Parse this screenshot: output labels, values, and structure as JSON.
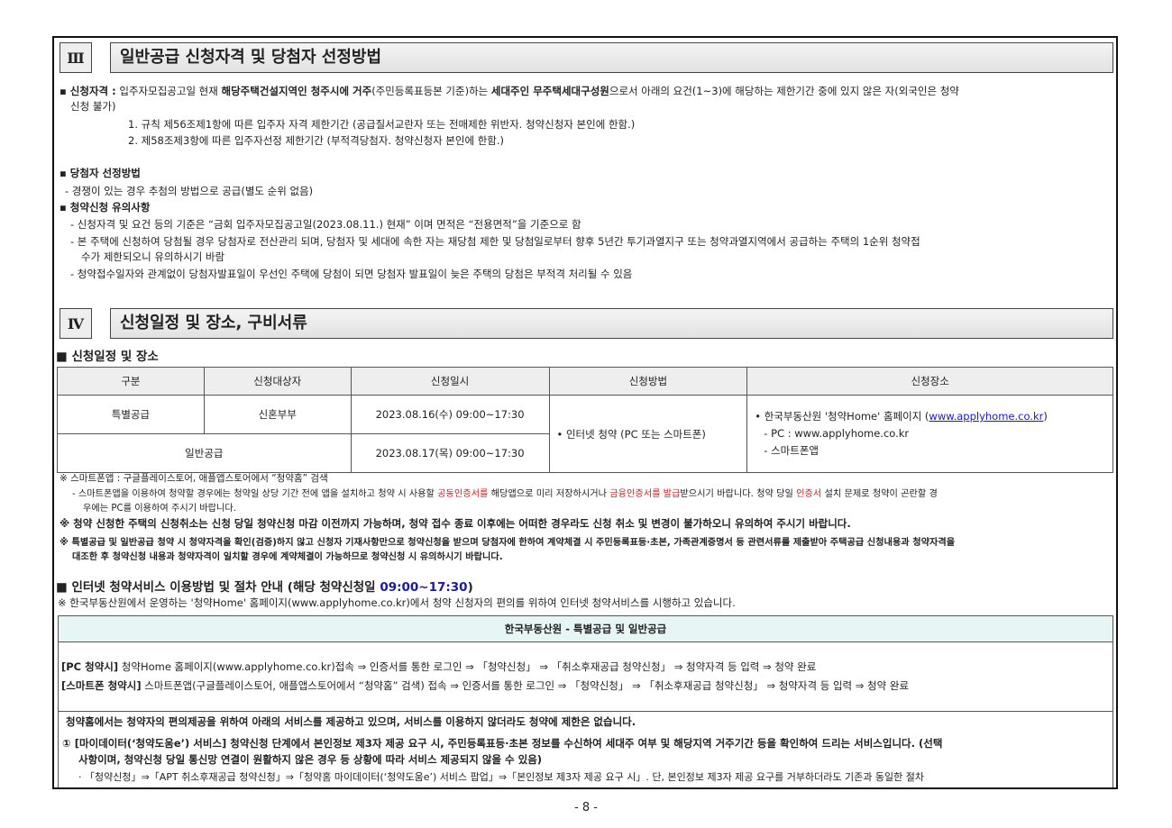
{
  "sec3": {
    "num": "Ⅲ",
    "title": "일반공급 신청자격 및 당첨자 선정방법",
    "qual_label": "▪ 신청자격 :",
    "qual_a": " 입주자모집공고일 현재 ",
    "qual_b": "해당주택건설지역인 청주시에 거주",
    "qual_c": "(주민등록표등본 기준)하는 ",
    "qual_d": "세대주인 무주택세대구성원",
    "qual_e": "으로서 아래의 요건(1~3)에 해당하는 제한기간 중에 있지 않은 자(외국인은 청약",
    "qual_cont": "신청 불가)",
    "rule1": "1. 규칙 제56조제1항에 따른 입주자 자격 제한기간 (공급질서교란자 또는 전매제한 위반자. 청약신청자 본인에 한함.)",
    "rule2": "2. 제58조제3항에 따른 입주자선정 제한기간 (부적격당첨자. 청약신청자 본인에 한함.)",
    "winner_head": "▪ 당첨자 선정방법",
    "winner_line": "- 경쟁이 있는 경우 추첨의 방법으로 공급(별도 순위 없음)",
    "caution_head": "▪ 청약신청 유의사항",
    "caution1": "- 신청자격 및 요건 등의 기준은 “금회 입주자모집공고일(2023.08.11.) 현재” 이며 면적은 “전용면적”을 기준으로 함",
    "caution2": "- 본 주택에 신청하여 당첨될 경우 당첨자로 전산관리 되며, 당첨자 및 세대에 속한 자는 재당첨 제한 및 당첨일로부터 향후 5년간 투기과열지구 또는 청약과열지역에서 공급하는 주택의 1순위 청약접",
    "caution2_cont": "수가 제한되오니 유의하시기 바람",
    "caution3": "- 청약접수일자와 관계없이 당첨자발표일이 우선인 주택에 당첨이 되면 당첨자 발표일이 늦은 주택의 당첨은 부적격 처리될 수 있음"
  },
  "sec4": {
    "num": "Ⅳ",
    "title": "신청일정 및 장소, 구비서류",
    "sched_head": "■ 신청일정 및 장소",
    "table": {
      "headers": [
        "구분",
        "신청대상자",
        "신청일시",
        "신청방법",
        "신청장소"
      ],
      "row1": [
        "특별공급",
        "신혼부부",
        "2023.08.16(수) 09:00~17:30"
      ],
      "row2": [
        "일반공급",
        "2023.08.17(목) 09:00~17:30"
      ],
      "method": "• 인터넷 청약 (PC 또는 스마트폰)",
      "place_a": "• 한국부동산원 '청약Home' 홈페이지 (",
      "place_link": "www.applyhome.co.kr",
      "place_b": ")",
      "place_pc": "- PC : www.applyhome.co.kr",
      "place_app": "- 스마트폰앱"
    },
    "note1": "※ 스마트폰앱 : 구글플레이스토어, 애플앱스토어에서 “청약홈” 검색",
    "note1_sub_a": "- 스마트폰앱을 이용하여 청약할 경우에는 청약일 상당 기간 전에 앱을 설치하고 청약 시 사용할 ",
    "note1_sub_r1": "공동인증서를",
    "note1_sub_b": " 해당앱으로 미리 저장하시거나 ",
    "note1_sub_r2": "금융인증서를 발급",
    "note1_sub_c": "받으시기 바랍니다. 청약 당일 ",
    "note1_sub_r3": "인증서",
    "note1_sub_d": " 설치 문제로 청약이 곤란할 경",
    "note1_sub_cont": "우에는 PC를 이용하여 주시기 바랍니다.",
    "note2": "※ 청약 신청한 주택의 신청취소는 신청 당일 청약신청 마감 이전까지 가능하며, 청약 접수 종료 이후에는 어떠한 경우라도 신청 취소 및 변경이 불가하오니 유의하여 주시기 바랍니다.",
    "note3": "※ 특별공급 및 일반공급 청약 시 청약자격을 확인(검증)하지 않고 신청자 기재사항만으로 청약신청을 받으며 당첨자에 한하여 계약체결 시 주민등록표등·초본, 가족관계증명서 등 관련서류를 제출받아 주택공급 신청내용과 청약자격을",
    "note3_cont": "대조한 후 청약신청 내용과 청약자격이 일치할 경우에 계약체결이 가능하므로 청약신청 시 유의하시기 바랍니다.",
    "net_head": "■ 인터넷 청약서비스 이용방법 및 절차 안내 (해당 청약신청일 ",
    "net_time": "09:00~17:30",
    "net_close": ")",
    "net_sub": "※ 한국부동산원에서 운영하는 '청약Home' 홈페이지(www.applyhome.co.kr)에서 청약 신청자의 편의를 위하여 인터넷 청약서비스를 시행하고 있습니다.",
    "box_title": "한국부동산원 - 특별공급 및 일반공급",
    "pc_label": "[PC 청약시]",
    "pc_text": " 청약Home 홈페이지(www.applyhome.co.kr)접속 ⇒ 인증서를 통한 로그인 ⇒ 「청약신청」 ⇒ 「취소후재공급 청약신청」 ⇒ 청약자격 등 입력 ⇒ 청약 완료",
    "sp_label": "[스마트폰 청약시]",
    "sp_text": " 스마트폰앱(구글플레이스토어, 애플앱스토어에서 “청약홈” 검색) 접속 ⇒ 인증서를 통한 로그인 ⇒ 「청약신청」 ⇒ 「취소후재공급 청약신청」 ⇒ 청약자격 등 입력 ⇒ 청약 완료",
    "svc_intro": "청약홈에서는 청약자의 편의제공을 위하여 아래의 서비스를 제공하고 있으며, 서비스를 이용하지 않더라도 청약에 제한은 없습니다.",
    "svc1": "① [마이데이터(‘청약도움e’) 서비스] 청약신청 단계에서 본인정보 제3자 제공 요구 시, 주민등록표등·초본 정보를 수신하여 세대주 여부 및 해당지역 거주기간 등을 확인하여 드리는 서비스입니다. (선택",
    "svc1_cont": "사항이며, 청약신청 당일 통신망 연결이 원활하지 않은 경우 등 상황에 따라 서비스 제공되지 않을 수 있음)",
    "svc1_sub": "· 「청약신청」⇒「APT 취소후재공급 청약신청」⇒「청약홈 마이데이터(‘청약도움e’) 서비스 팝업」⇒「본인정보 제3자 제공 요구 시」. 단, 본인정보 제3자 제공 요구를 거부하더라도 기존과 동일한 절차"
  },
  "page_number": "- 8 -"
}
